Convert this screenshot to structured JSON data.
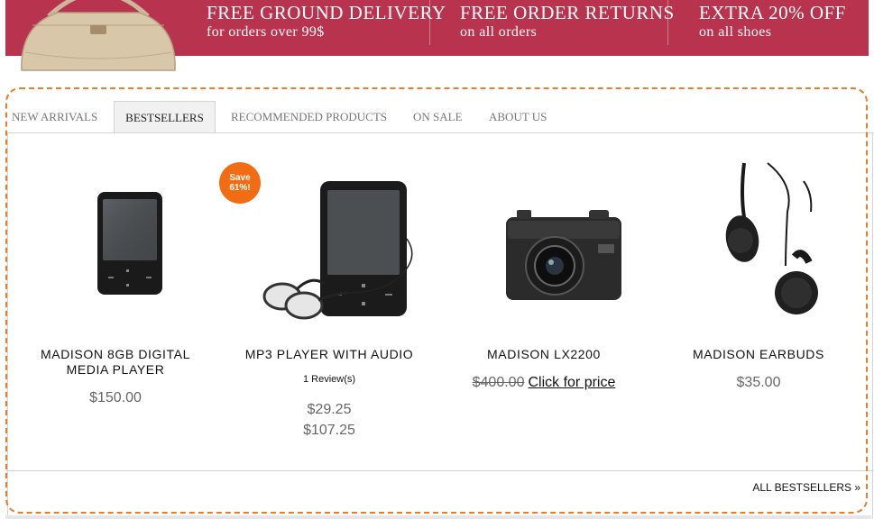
{
  "banner": {
    "bg_color": "#b8344e",
    "promos": [
      {
        "title": "FREE GROUND DELIVERY",
        "subtitle": "for orders over 99$"
      },
      {
        "title": "FREE ORDER RETURNS",
        "subtitle": "on all orders"
      },
      {
        "title": "EXTRA 20% OFF",
        "subtitle": "on all shoes"
      }
    ]
  },
  "frame_color": "#e87d2a",
  "tabs": [
    {
      "label": "NEW ARRIVALS",
      "active": false
    },
    {
      "label": "BESTSELLERS",
      "active": true
    },
    {
      "label": "RECOMMENDED PRODUCTS",
      "active": false
    },
    {
      "label": "ON SALE",
      "active": false
    },
    {
      "label": "ABOUT US",
      "active": false
    }
  ],
  "products": [
    {
      "name": "MADISON 8GB DIGITAL MEDIA PLAYER",
      "price": "$150.00",
      "image": "media-player-icon"
    },
    {
      "name": "MP3 PLAYER WITH AUDIO",
      "badge": {
        "line1": "Save",
        "line2": "61%!",
        "color": "#f26c13"
      },
      "reviews": "1 Review(s)",
      "price_from": "$29.25",
      "price_to": "$107.25",
      "image": "mp3-player-with-earphones-icon"
    },
    {
      "name": "MADISON LX2200",
      "old_price": "$400.00",
      "price_link": "Click for price",
      "image": "camera-icon"
    },
    {
      "name": "MADISON EARBUDS",
      "price": "$35.00",
      "image": "earbuds-icon"
    }
  ],
  "footer": {
    "all_link": "ALL BESTSELLERS »"
  }
}
